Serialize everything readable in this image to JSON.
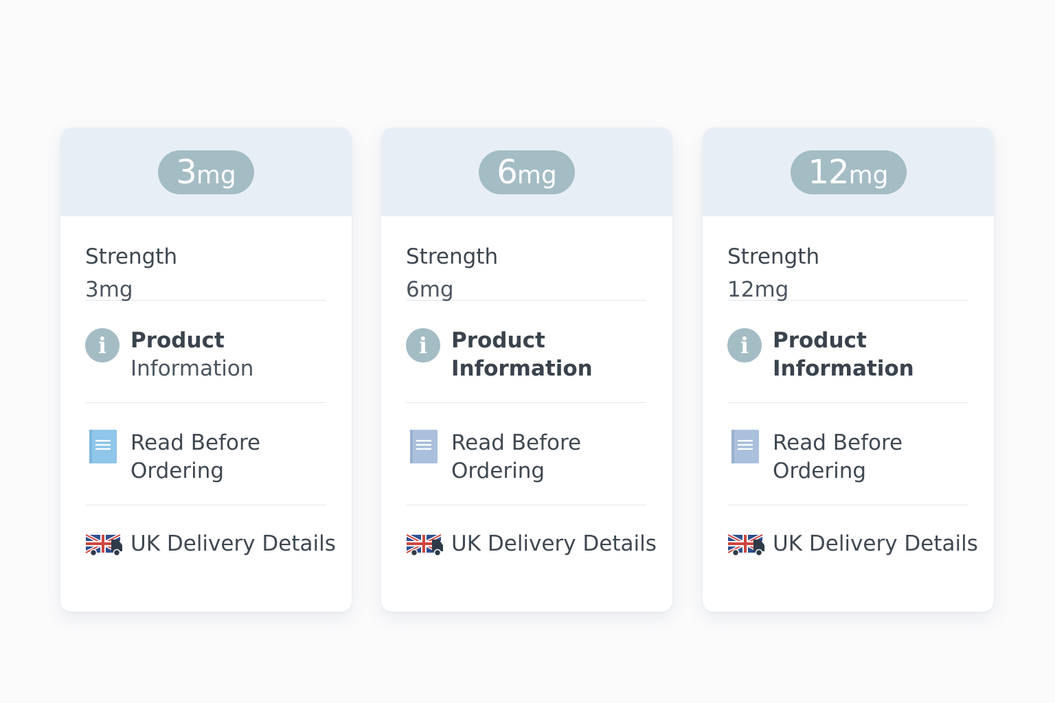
{
  "cards": [
    {
      "badge_number": "3",
      "badge_unit": "mg",
      "strength_label": "Strength",
      "strength_value": "3mg",
      "info_line1": "Product",
      "info_line2": "Information",
      "read_line1": "Read Before",
      "read_line2": "Ordering",
      "delivery_label": "UK Delivery Details"
    },
    {
      "badge_number": "6",
      "badge_unit": "mg",
      "strength_label": "Strength",
      "strength_value": "6mg",
      "info_line1": "Product",
      "info_line2": "Information",
      "read_line1": "Read Before",
      "read_line2": "Ordering",
      "delivery_label": "UK Delivery Details"
    },
    {
      "badge_number": "12",
      "badge_unit": "mg",
      "strength_label": "Strength",
      "strength_value": "12mg",
      "info_line1": "Product",
      "info_line2": "Information",
      "read_line1": "Read Before",
      "read_line2": "Ordering",
      "delivery_label": "UK Delivery Details"
    }
  ],
  "icons": {
    "info": "info-icon",
    "read": "document-icon",
    "delivery": "uk-delivery-van-icon",
    "info_glyph": "i"
  },
  "colors": {
    "header_bg": "#e8eef5",
    "badge_bg": "#a4bcc4",
    "doc_icon_first": "#8fc6ea",
    "doc_icon_other": "#aac0dc",
    "divider": "#e3e7ec"
  }
}
